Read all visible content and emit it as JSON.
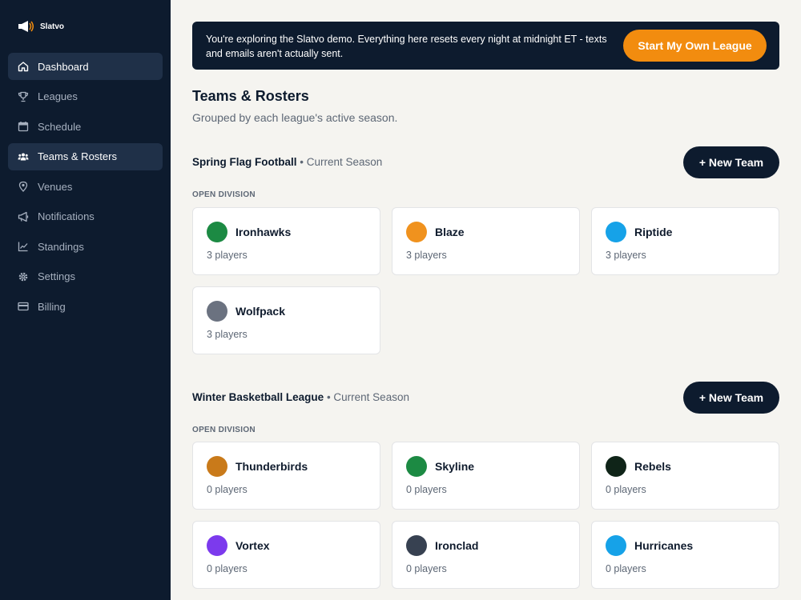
{
  "brand": {
    "name": "Slatvo"
  },
  "sidebar": {
    "items": [
      {
        "label": "Dashboard",
        "icon": "home-icon",
        "active": true
      },
      {
        "label": "Leagues",
        "icon": "trophy-icon",
        "active": false
      },
      {
        "label": "Schedule",
        "icon": "calendar-icon",
        "active": false
      },
      {
        "label": "Teams & Rosters",
        "icon": "users-icon",
        "active": true
      },
      {
        "label": "Venues",
        "icon": "map-pin-icon",
        "active": false
      },
      {
        "label": "Notifications",
        "icon": "megaphone-icon",
        "active": false
      },
      {
        "label": "Standings",
        "icon": "chart-line-icon",
        "active": false
      },
      {
        "label": "Settings",
        "icon": "gear-icon",
        "active": false
      },
      {
        "label": "Billing",
        "icon": "credit-card-icon",
        "active": false
      }
    ]
  },
  "banner": {
    "text": "You're exploring the Slatvo demo. Everything here resets every night at midnight ET - texts and emails aren't actually sent.",
    "cta": "Start My Own League"
  },
  "page": {
    "title": "Teams & Rosters",
    "subtitle": "Grouped by each league's active season."
  },
  "sections": [
    {
      "name": "Spring Flag Football",
      "season": " • Current Season",
      "button": "+ New Team",
      "division": "OPEN DIVISION",
      "teams": [
        {
          "name": "Ironhawks",
          "players": "3 players",
          "color": "#1c8a43"
        },
        {
          "name": "Blaze",
          "players": "3 players",
          "color": "#f0921e"
        },
        {
          "name": "Riptide",
          "players": "3 players",
          "color": "#16a2e8"
        },
        {
          "name": "Wolfpack",
          "players": "3 players",
          "color": "#6b7280"
        }
      ]
    },
    {
      "name": "Winter Basketball League",
      "season": " • Current Season",
      "button": "+ New Team",
      "division": "OPEN DIVISION",
      "teams": [
        {
          "name": "Thunderbirds",
          "players": "0 players",
          "color": "#c97a1a"
        },
        {
          "name": "Skyline",
          "players": "0 players",
          "color": "#1c8a43"
        },
        {
          "name": "Rebels",
          "players": "0 players",
          "color": "#0f2418"
        },
        {
          "name": "Vortex",
          "players": "0 players",
          "color": "#7c3aed"
        },
        {
          "name": "Ironclad",
          "players": "0 players",
          "color": "#374151"
        },
        {
          "name": "Hurricanes",
          "players": "0 players",
          "color": "#16a2e8"
        }
      ]
    }
  ]
}
